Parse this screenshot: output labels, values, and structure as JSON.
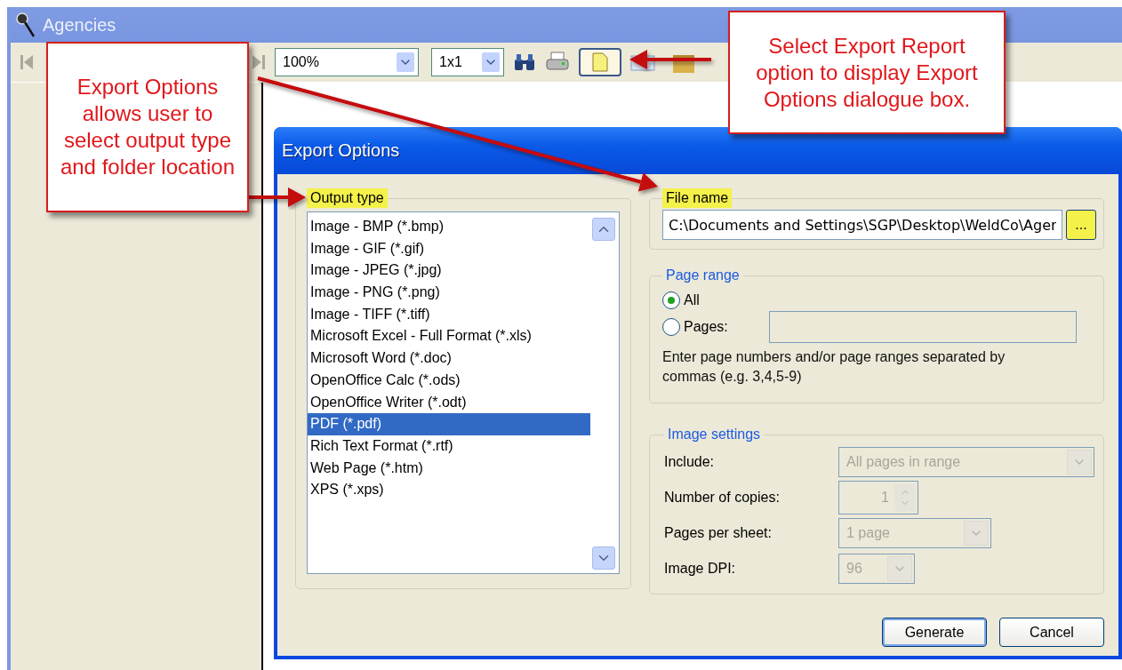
{
  "window": {
    "title": "Agencies"
  },
  "toolbar": {
    "zoom": {
      "value": "100%"
    },
    "layout": {
      "value": "1x1"
    },
    "export_button": {
      "selected": true
    }
  },
  "dialog": {
    "title": "Export Options",
    "output_type": {
      "label": "Output type",
      "highlighted": true,
      "items": [
        {
          "label": "Image - BMP (*.bmp)",
          "selected": false
        },
        {
          "label": "Image - GIF (*.gif)",
          "selected": false
        },
        {
          "label": "Image - JPEG (*.jpg)",
          "selected": false
        },
        {
          "label": "Image - PNG (*.png)",
          "selected": false
        },
        {
          "label": "Image - TIFF (*.tiff)",
          "selected": false
        },
        {
          "label": "Microsoft Excel - Full Format (*.xls)",
          "selected": false
        },
        {
          "label": "Microsoft Word (*.doc)",
          "selected": false
        },
        {
          "label": "OpenOffice Calc (*.ods)",
          "selected": false
        },
        {
          "label": "OpenOffice Writer (*.odt)",
          "selected": false
        },
        {
          "label": "PDF (*.pdf)",
          "selected": true
        },
        {
          "label": "Rich Text Format (*.rtf)",
          "selected": false
        },
        {
          "label": "Web Page (*.htm)",
          "selected": false
        },
        {
          "label": "XPS (*.xps)",
          "selected": false
        }
      ]
    },
    "file_name": {
      "label": "File name",
      "highlighted": true,
      "value": "C:\\Documents and Settings\\SGP\\Desktop\\WeldCo\\Ager",
      "browse": "...",
      "browse_highlighted": true
    },
    "page_range": {
      "label": "Page range",
      "options": [
        {
          "label": "All",
          "selected": true
        },
        {
          "label": "Pages:",
          "selected": false
        }
      ],
      "hint": "Enter page numbers and/or page ranges separated by commas (e.g. 3,4,5-9)"
    },
    "image_settings": {
      "label": "Image settings",
      "rows": [
        {
          "label": "Include:",
          "kind": "select",
          "value": "All pages in range",
          "disabled": true
        },
        {
          "label": "Number of copies:",
          "kind": "spinner",
          "value": "1",
          "disabled": true
        },
        {
          "label": "Pages per sheet:",
          "kind": "select",
          "value": "1 page",
          "disabled": true
        },
        {
          "label": "Image DPI:",
          "kind": "select",
          "value": "96",
          "disabled": true
        }
      ]
    },
    "buttons": [
      {
        "label": "Generate",
        "default": true
      },
      {
        "label": "Cancel",
        "default": false
      }
    ]
  },
  "callouts": [
    {
      "text": "Export Options allows user to select output type and folder location"
    },
    {
      "text": "Select Export Report option to display Export Options dialogue box."
    }
  ]
}
